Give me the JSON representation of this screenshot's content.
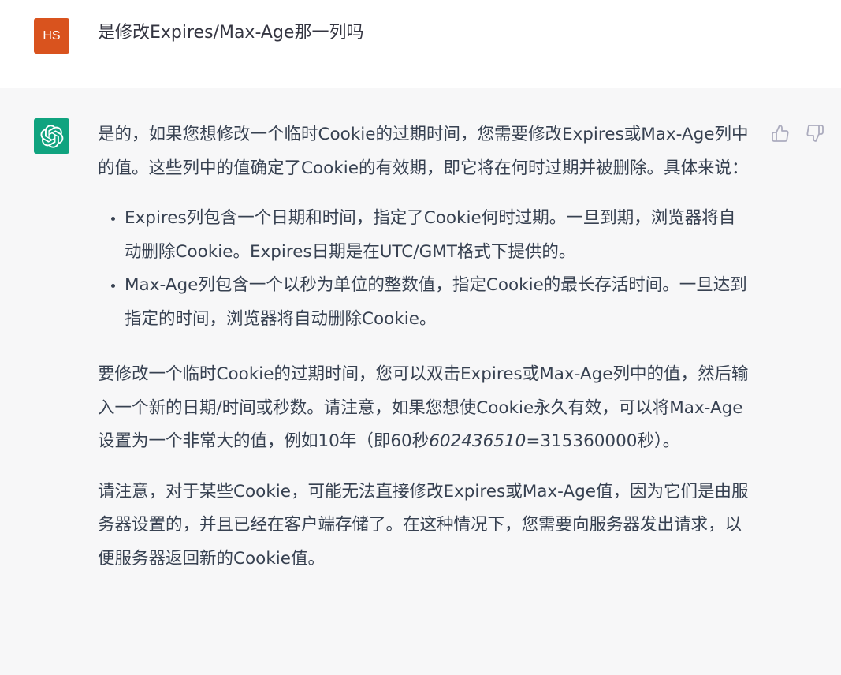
{
  "user": {
    "avatar_initials": "HS",
    "avatar_color": "#d9531e",
    "message": "是修改Expires/Max-Age那一列吗"
  },
  "assistant": {
    "avatar_icon": "openai-logo-icon",
    "avatar_color": "#10a37f",
    "paragraph_1": "是的，如果您想修改一个临时Cookie的过期时间，您需要修改Expires或Max-Age列中的值。这些列中的值确定了Cookie的有效期，即它将在何时过期并被删除。具体来说：",
    "bullets": [
      "Expires列包含一个日期和时间，指定了Cookie何时过期。一旦到期，浏览器将自动删除Cookie。Expires日期是在UTC/GMT格式下提供的。",
      "Max-Age列包含一个以秒为单位的整数值，指定Cookie的最长存活时间。一旦达到指定的时间，浏览器将自动删除Cookie。"
    ],
    "paragraph_2_start": "要修改一个临时Cookie的过期时间，您可以双击Expires或Max-Age列中的值，然后输入一个新的日期/时间或秒数。请注意，如果您想使Cookie永久有效，可以将Max-Age设置为一个非常大的值，例如10年（即60秒",
    "paragraph_2_italic": "602436510",
    "paragraph_2_end": "=315360000秒）。",
    "paragraph_3": "请注意，对于某些Cookie，可能无法直接修改Expires或Max-Age值，因为它们是由服务器设置的，并且已经在客户端存储了。在这种情况下，您需要向服务器发出请求，以便服务器返回新的Cookie值。"
  },
  "feedback": {
    "thumbs_up_icon": "thumbs-up-icon",
    "thumbs_down_icon": "thumbs-down-icon"
  }
}
